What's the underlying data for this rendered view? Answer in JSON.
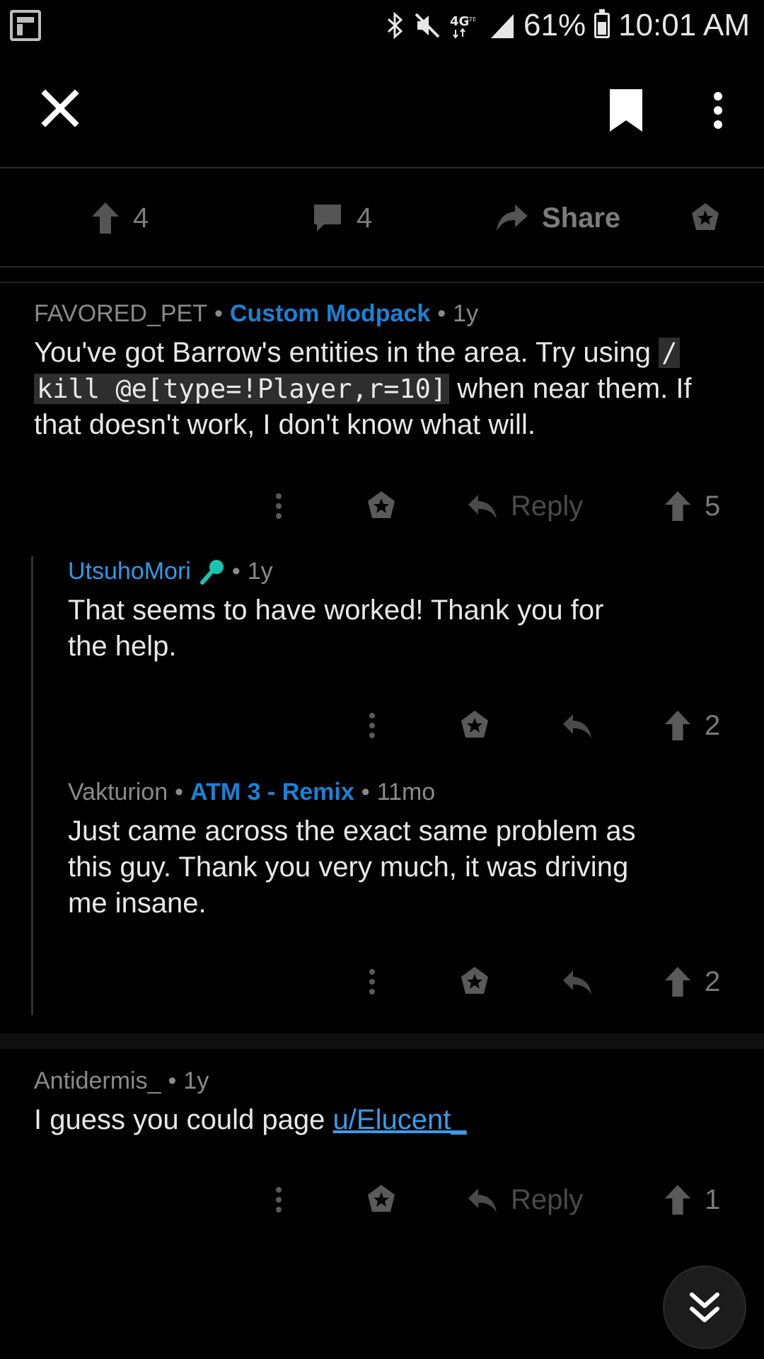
{
  "status_bar": {
    "network": "4G LTE",
    "battery": "61%",
    "time": "10:01 AM",
    "icons": [
      "flipboard-icon",
      "bluetooth-icon",
      "mute-icon",
      "signal-icon",
      "battery-icon"
    ]
  },
  "toolbar": {
    "close_icon": "close-icon",
    "bookmark_icon": "bookmark-icon",
    "more_icon": "more-vertical-icon"
  },
  "action_bar": {
    "upvotes": "4",
    "comments": "4",
    "share_label": "Share"
  },
  "comments": [
    {
      "author": "FAVORED_PET",
      "flair": "Custom Modpack",
      "age": "1y",
      "body_prefix": "You've got Barrow's entities in the area. Try using ",
      "body_code_a": "/",
      "body_code_b": "kill @e[type=!Player,r=10]",
      "body_suffix": " when near them. If that doesn't work, I don't know what will.",
      "reply_label": "Reply",
      "score": "5"
    },
    {
      "author": "UtsuhoMori",
      "age": "1y",
      "body": "That seems to have worked! Thank you for the help.",
      "score": "2"
    },
    {
      "author": "Vakturion",
      "flair": "ATM 3 - Remix",
      "age": "11mo",
      "body": "Just came across the exact same problem as this guy. Thank you very much, it was driving me insane.",
      "score": "2"
    },
    {
      "author": "Antidermis_",
      "age": "1y",
      "body_prefix": "I guess you could page ",
      "body_link": "u/Elucent_",
      "reply_label": "Reply",
      "score": "1"
    }
  ],
  "colors": {
    "background": "#000000",
    "flair": "#1a82d6",
    "link": "#3a9be8",
    "mic_badge": "#19c3b0"
  }
}
